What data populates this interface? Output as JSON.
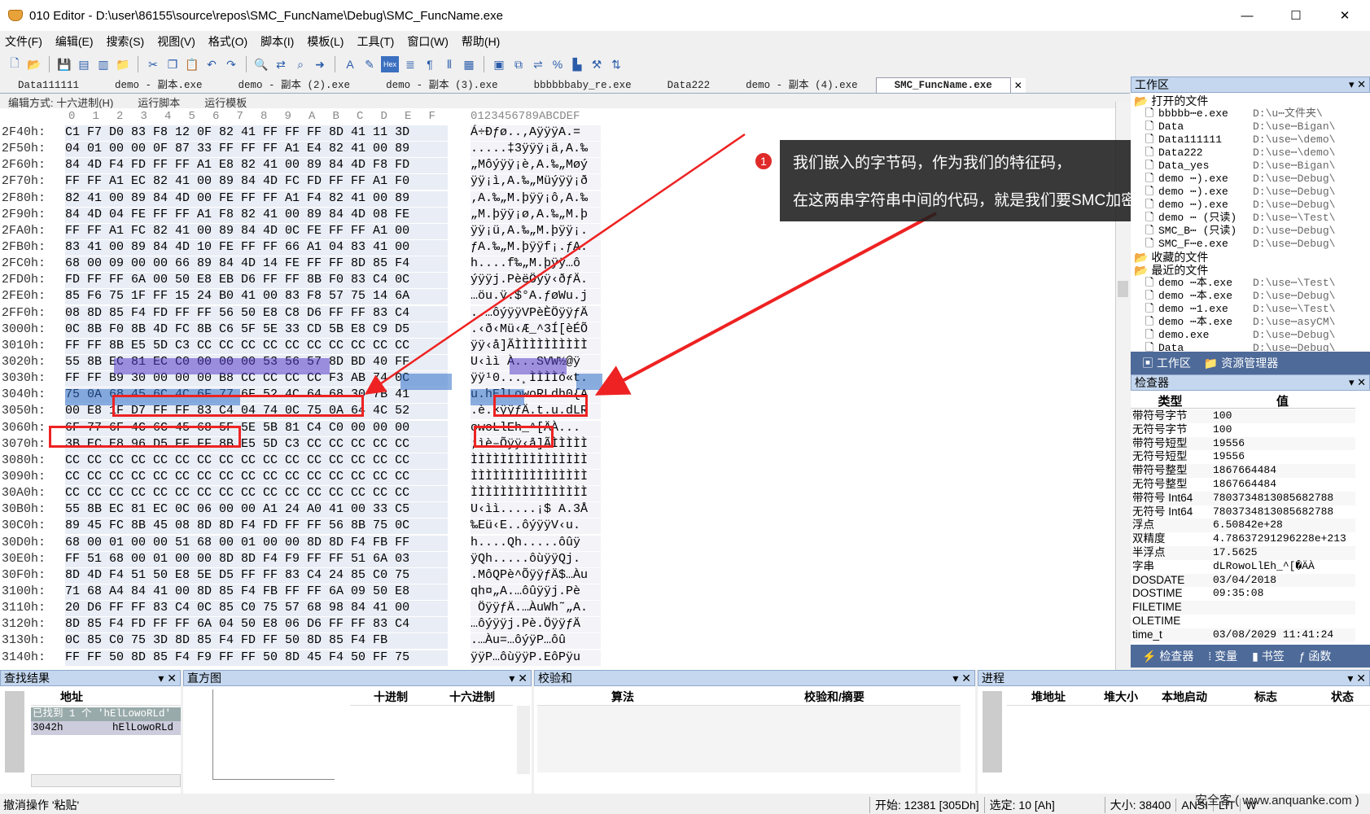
{
  "window": {
    "title": "010 Editor - D:\\user\\86155\\source\\repos\\SMC_FuncName\\Debug\\SMC_FuncName.exe",
    "min": "—",
    "max": "☐",
    "close": "✕"
  },
  "menu": [
    "文件(F)",
    "编辑(E)",
    "搜索(S)",
    "视图(V)",
    "格式(O)",
    "脚本(I)",
    "模板(L)",
    "工具(T)",
    "窗口(W)",
    "帮助(H)"
  ],
  "tabs": [
    "Data111111",
    "demo - 副本.exe",
    "demo - 副本 (2).exe",
    "demo - 副本 (3).exe",
    "bbbbbbaby_re.exe",
    "Data222",
    "demo - 副本 (4).exe",
    "SMC_FuncName.exe"
  ],
  "editbar": {
    "mode": "编辑方式: 十六进制(H)",
    "script": "运行脚本",
    "template": "运行模板"
  },
  "hex": {
    "col_headers": [
      "0",
      "1",
      "2",
      "3",
      "4",
      "5",
      "6",
      "7",
      "8",
      "9",
      "A",
      "B",
      "C",
      "D",
      "E",
      "F"
    ],
    "ascii_header": "0123456789ABCDEF",
    "rows": [
      {
        "a": "2F40h:",
        "b": "C1 F7 D0 83 F8 12 0F 82 41 FF FF FF 8D 41 11 3D",
        "s": "Á÷Ðƒø..‚AÿÿÿA.="
      },
      {
        "a": "2F50h:",
        "b": "04 01 00 00 0F 87 33 FF FF FF A1 E4 82 41 00 89",
        "s": ".....‡3ÿÿÿ¡ä‚A.‰"
      },
      {
        "a": "2F60h:",
        "b": "84 4D F4 FD FF FF A1 E8 82 41 00 89 84 4D F8 FD",
        "s": "„Môýÿÿ¡è‚A.‰„Møý"
      },
      {
        "a": "2F70h:",
        "b": "FF FF A1 EC 82 41 00 89 84 4D FC FD FF FF A1 F0",
        "s": "ÿÿ¡ì‚A.‰„Müýÿÿ¡ð"
      },
      {
        "a": "2F80h:",
        "b": "82 41 00 89 84 4D 00 FE FF FF A1 F4 82 41 00 89",
        "s": "‚A.‰„M.þÿÿ¡ô‚A.‰"
      },
      {
        "a": "2F90h:",
        "b": "84 4D 04 FE FF FF A1 F8 82 41 00 89 84 4D 08 FE",
        "s": "„M.þÿÿ¡ø‚A.‰„M.þ"
      },
      {
        "a": "2FA0h:",
        "b": "FF FF A1 FC 82 41 00 89 84 4D 0C FE FF FF A1 00",
        "s": "ÿÿ¡ü‚A.‰„M.þÿÿ¡."
      },
      {
        "a": "2FB0h:",
        "b": "83 41 00 89 84 4D 10 FE FF FF 66 A1 04 83 41 00",
        "s": "ƒA.‰„M.þÿÿf¡.ƒA."
      },
      {
        "a": "2FC0h:",
        "b": "68 00 09 00 00 66 89 84 4D 14 FE FF FF 8D 85 F4",
        "s": "h....f‰„M.þÿÿ…ô"
      },
      {
        "a": "2FD0h:",
        "b": "FD FF FF 6A 00 50 E8 EB D6 FF FF 8B F0 83 C4 0C",
        "s": "ýÿÿj.PèëÖÿÿ‹ðƒÄ."
      },
      {
        "a": "2FE0h:",
        "b": "85 F6 75 1F FF 15 24 B0 41 00 83 F8 57 75 14 6A",
        "s": "…öu.ÿ.$°A.ƒøWu.j"
      },
      {
        "a": "2FF0h:",
        "b": "08 8D 85 F4 FD FF FF 56 50 E8 C8 D6 FF FF 83 C4",
        "s": "..…ôýÿÿVPèÈÖÿÿƒÄ"
      },
      {
        "a": "3000h:",
        "b": "0C 8B F0 8B 4D FC 8B C6 5F 5E 33 CD 5B E8 C9 D5",
        "s": ".‹ð‹Mü‹Æ_^3Í[èÉÕ"
      },
      {
        "a": "3010h:",
        "b": "FF FF 8B E5 5D C3 CC CC CC CC CC CC CC CC CC CC",
        "s": "ÿÿ‹å]ÃÌÌÌÌÌÌÌÌÌÌ"
      },
      {
        "a": "3020h:",
        "b": "55 8B EC 81 EC C0 00 00 00 53 56 57 8D BD 40 FF",
        "s": "U‹ìì À...SVW½@ÿ"
      },
      {
        "a": "3030h:",
        "b": "FF FF B9 30 00 00 00 B8 CC CC CC CC F3 AB 74 0C",
        "s": "ÿÿ¹0...¸ÌÌÌÌó«t."
      },
      {
        "a": "3040h:",
        "b": "75 0A 68 45 6C 4C 6F 77 6F 52 4C 64 68 30 7B 41",
        "s": "u.hElLowoRLdh0{A"
      },
      {
        "a": "3050h:",
        "b": "00 E8 1F D7 FF FF 83 C4 04 74 0C 75 0A 64 4C 52",
        "s": ".è.×ÿÿƒÄ.t.u.dLR"
      },
      {
        "a": "3060h:",
        "b": "6F 77 6F 4C 6C 45 68 5F 5E 5B 81 C4 C0 00 00 00",
        "s": "owoLlEh_^[ÄÀ..."
      },
      {
        "a": "3070h:",
        "b": "3B EC E8 96 D5 FF FF 8B E5 5D C3 CC CC CC CC CC",
        "s": ";ìè–Õÿÿ‹å]ÃÌÌÌÌÌ"
      },
      {
        "a": "3080h:",
        "b": "CC CC CC CC CC CC CC CC CC CC CC CC CC CC CC CC",
        "s": "ÌÌÌÌÌÌÌÌÌÌÌÌÌÌÌÌ"
      },
      {
        "a": "3090h:",
        "b": "CC CC CC CC CC CC CC CC CC CC CC CC CC CC CC CC",
        "s": "ÌÌÌÌÌÌÌÌÌÌÌÌÌÌÌÌ"
      },
      {
        "a": "30A0h:",
        "b": "CC CC CC CC CC CC CC CC CC CC CC CC CC CC CC CC",
        "s": "ÌÌÌÌÌÌÌÌÌÌÌÌÌÌÌÌ"
      },
      {
        "a": "30B0h:",
        "b": "55 8B EC 81 EC 0C 06 00 00 A1 24 A0 41 00 33 C5",
        "s": "U‹ìì.....¡$ A.3Å"
      },
      {
        "a": "30C0h:",
        "b": "89 45 FC 8B 45 08 8D 8D F4 FD FF FF 56 8B 75 0C",
        "s": "‰Eü‹E..ôýÿÿV‹u."
      },
      {
        "a": "30D0h:",
        "b": "68 00 01 00 00 51 68 00 01 00 00 8D 8D F4 FB FF",
        "s": "h....Qh.....ôûÿ"
      },
      {
        "a": "30E0h:",
        "b": "FF 51 68 00 01 00 00 8D 8D F4 F9 FF FF 51 6A 03",
        "s": "ÿQh.....ôùÿÿQj."
      },
      {
        "a": "30F0h:",
        "b": "8D 4D F4 51 50 E8 5E D5 FF FF 83 C4 24 85 C0 75",
        "s": ".MôQPè^ÕÿÿƒÄ$…Àu"
      },
      {
        "a": "3100h:",
        "b": "71 68 A4 84 41 00 8D 85 F4 FB FF FF 6A 09 50 E8",
        "s": "qh¤„A.…ôûÿÿj.Pè"
      },
      {
        "a": "3110h:",
        "b": "20 D6 FF FF 83 C4 0C 85 C0 75 57 68 98 84 41 00",
        "s": " ÖÿÿƒÄ.…ÀuWh˜„A."
      },
      {
        "a": "3120h:",
        "b": "8D 85 F4 FD FF FF 6A 04 50 E8 06 D6 FF FF 83 C4",
        "s": "…ôýÿÿj.Pè.ÖÿÿƒÄ"
      },
      {
        "a": "3130h:",
        "b": "0C 85 C0 75 3D 8D 85 F4 FD FF 50 8D 85 F4 FB",
        "s": ".…Àu=…ôýÿP…ôû"
      },
      {
        "a": "3140h:",
        "b": "FF FF 50 8D 85 F4 F9 FF FF 50 8D 45 F4 50 FF 75",
        "s": "ÿÿP…ôùÿÿP.EôPÿu"
      }
    ]
  },
  "callout": {
    "badge": "1",
    "line1": "我们嵌入的字节码，作为我们的特征码，",
    "line2": "在这两串字符串中间的代码，就是我们要SMC加密的函数。"
  },
  "workspace": {
    "title": "工作区",
    "open_group": "打开的文件",
    "open": [
      {
        "n": "bbbbb⋯e.exe",
        "p": "D:\\u⋯文件夹\\"
      },
      {
        "n": "Data",
        "p": "D:\\use⋯Bigan\\"
      },
      {
        "n": "Data111111",
        "p": "D:\\use⋯\\demo\\"
      },
      {
        "n": "Data222",
        "p": "D:\\use⋯\\demo\\"
      },
      {
        "n": "Data_yes",
        "p": "D:\\use⋯Bigan\\"
      },
      {
        "n": "demo ⋯).exe",
        "p": "D:\\use⋯Debug\\"
      },
      {
        "n": "demo ⋯).exe",
        "p": "D:\\use⋯Debug\\"
      },
      {
        "n": "demo ⋯).exe",
        "p": "D:\\use⋯Debug\\"
      },
      {
        "n": "demo ⋯ (只读)",
        "p": "D:\\use⋯\\Test\\"
      },
      {
        "n": "SMC_B⋯ (只读)",
        "p": "D:\\use⋯Debug\\"
      },
      {
        "n": "SMC_F⋯e.exe",
        "p": "D:\\use⋯Debug\\"
      }
    ],
    "fav_group": "收藏的文件",
    "recent_group": "最近的文件",
    "recent": [
      {
        "n": "demo ⋯本.exe",
        "p": "D:\\use⋯\\Test\\"
      },
      {
        "n": "demo ⋯本.exe",
        "p": "D:\\use⋯Debug\\"
      },
      {
        "n": "demo ⋯1.exe",
        "p": "D:\\use⋯\\Test\\"
      },
      {
        "n": "demo ⋯本.exe",
        "p": "D:\\use⋯asyCM\\"
      },
      {
        "n": "demo.exe",
        "p": "D:\\use⋯Debug\\"
      },
      {
        "n": "Data",
        "p": "D:\\use⋯Debug\\"
      }
    ],
    "tab1": "工作区",
    "tab2": "资源管理器"
  },
  "inspector": {
    "title": "检查器",
    "col_type": "类型",
    "col_value": "值",
    "rows": [
      {
        "t": "带符号字节",
        "v": "100"
      },
      {
        "t": "无符号字节",
        "v": "100"
      },
      {
        "t": "带符号短型",
        "v": "19556"
      },
      {
        "t": "无符号短型",
        "v": "19556"
      },
      {
        "t": "带符号整型",
        "v": "1867664484"
      },
      {
        "t": "无符号整型",
        "v": "1867664484"
      },
      {
        "t": "带符号 Int64",
        "v": "7803734813085682788"
      },
      {
        "t": "无符号 Int64",
        "v": "7803734813085682788"
      },
      {
        "t": "浮点",
        "v": "6.50842e+28"
      },
      {
        "t": "双精度",
        "v": "4.78637291296228e+213"
      },
      {
        "t": "半浮点",
        "v": "17.5625"
      },
      {
        "t": "字串",
        "v": "dLRowoLlEh_^[�ÄÀ"
      },
      {
        "t": "DOSDATE",
        "v": "03/04/2018"
      },
      {
        "t": "DOSTIME",
        "v": "09:35:08"
      },
      {
        "t": "FILETIME",
        "v": ""
      },
      {
        "t": "OLETIME",
        "v": ""
      },
      {
        "t": "time_t",
        "v": "03/08/2029 11:41:24"
      }
    ],
    "tabs": [
      "检查器",
      "变量",
      "书签",
      "函数"
    ]
  },
  "find": {
    "title": "查找结果",
    "col": "地址",
    "r1a": "已找到 1 个 'hElLowoRLd'",
    "r2a": "3042h",
    "r2b": "hElLowoRLd"
  },
  "histogram": {
    "title": "直方图",
    "col1": "十进制",
    "col2": "十六进制"
  },
  "checksum": {
    "title": "校验和",
    "col1": "算法",
    "col2": "校验和/摘要"
  },
  "process": {
    "title": "进程",
    "cols": [
      "堆地址",
      "堆大小",
      "本地启动",
      "标志",
      "状态"
    ]
  },
  "status": {
    "left": "撤消操作 '粘贴'",
    "start": "开始: 12381 [305Dh]",
    "sel": "选定: 10 [Ah]",
    "size": "大小: 38400",
    "enc": "ANSI",
    "lit": "LIT",
    "w": "W"
  },
  "watermark": "安全客 ( www.anquanke.com )"
}
